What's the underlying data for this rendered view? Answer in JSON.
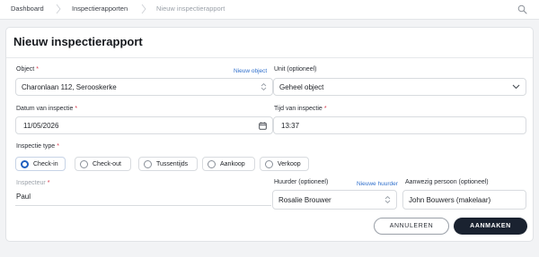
{
  "breadcrumb": {
    "items": [
      "Dashboard",
      "Inspectierapporten",
      "Nieuw inspectierapport"
    ]
  },
  "icons": {
    "search": "search-icon",
    "calendar": "calendar-icon",
    "select": "select-arrows-icon",
    "dropdown": "chevron-down-icon",
    "separator": "chevron-right-icon"
  },
  "form": {
    "title": "Nieuw inspectierapport",
    "object": {
      "label": "Object",
      "link": "Nieuw object",
      "value": "Charonlaan 112, Serooskerke"
    },
    "unit": {
      "label": "Unit (optioneel)",
      "value": "Geheel object"
    },
    "date": {
      "label": "Datum van inspectie",
      "value": "11/05/2026"
    },
    "time": {
      "label": "Tijd van inspectie",
      "value": "13:37"
    },
    "type": {
      "label": "Inspectie type",
      "options": [
        "Check-in",
        "Check-out",
        "Tussentijds",
        "Aankoop",
        "Verkoop"
      ],
      "selected": "Check-in"
    },
    "inspector": {
      "label": "Inspecteur",
      "value": "Paul"
    },
    "tenant": {
      "label": "Huurder (optioneel)",
      "link": "Nieuwe huurder",
      "value": "Rosalie Brouwer"
    },
    "present": {
      "label": "Aanwezig persoon (optioneel)",
      "value": "John Bouwers (makelaar)"
    }
  },
  "actions": {
    "cancel": "ANNULEREN",
    "submit": "AANMAKEN"
  },
  "colors": {
    "accent": "#1f5fbf",
    "required": "#d9364a",
    "primary_button": "#1a2230",
    "link": "#2f6fcc"
  }
}
